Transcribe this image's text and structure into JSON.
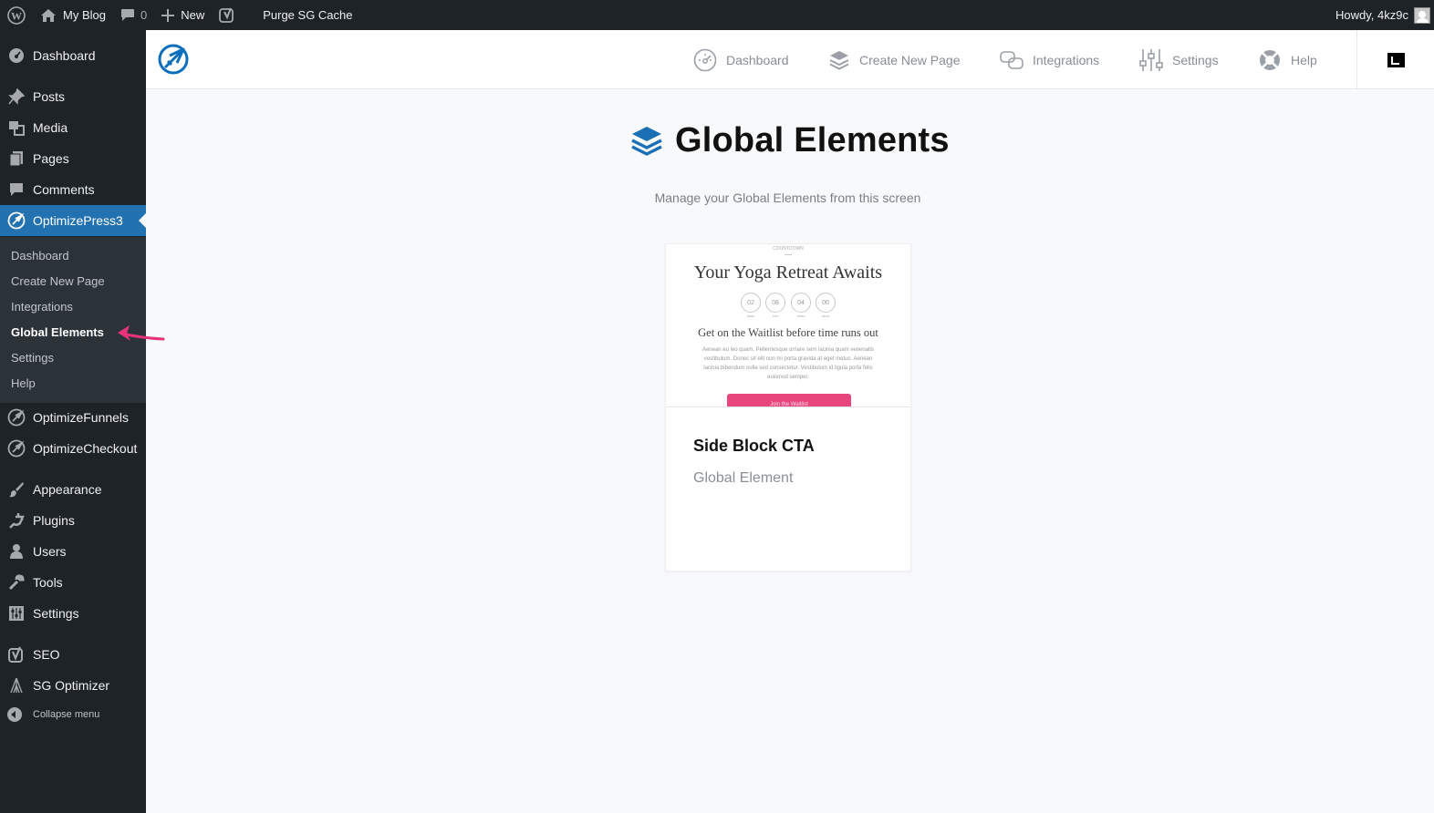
{
  "admin_bar": {
    "site_name": "My Blog",
    "comments_count": "0",
    "new_label": "New",
    "purge_label": "Purge SG Cache",
    "greeting": "Howdy, 4kz9c"
  },
  "sidebar": {
    "items": [
      {
        "label": "Dashboard",
        "icon": "dashboard-gauge-icon"
      },
      {
        "label": "Posts",
        "icon": "pushpin-icon"
      },
      {
        "label": "Media",
        "icon": "media-icon"
      },
      {
        "label": "Pages",
        "icon": "pages-icon"
      },
      {
        "label": "Comments",
        "icon": "comment-bubble-icon"
      },
      {
        "label": "OptimizePress3",
        "icon": "optimizepress-icon"
      },
      {
        "label": "OptimizeFunnels",
        "icon": "optimizepress-icon"
      },
      {
        "label": "OptimizeCheckout",
        "icon": "optimizepress-icon"
      },
      {
        "label": "Appearance",
        "icon": "paintbrush-icon"
      },
      {
        "label": "Plugins",
        "icon": "plug-icon"
      },
      {
        "label": "Users",
        "icon": "user-icon"
      },
      {
        "label": "Tools",
        "icon": "wrench-icon"
      },
      {
        "label": "Settings",
        "icon": "settings-sliders-icon"
      },
      {
        "label": "SEO",
        "icon": "yoast-icon"
      },
      {
        "label": "SG Optimizer",
        "icon": "sg-optimizer-icon"
      }
    ],
    "submenu": [
      {
        "label": "Dashboard"
      },
      {
        "label": "Create New Page"
      },
      {
        "label": "Integrations"
      },
      {
        "label": "Global Elements"
      },
      {
        "label": "Settings"
      },
      {
        "label": "Help"
      }
    ],
    "collapse_label": "Collapse menu"
  },
  "topnav": {
    "links": [
      {
        "label": "Dashboard",
        "icon": "gauge-icon"
      },
      {
        "label": "Create New Page",
        "icon": "layers-icon"
      },
      {
        "label": "Integrations",
        "icon": "integrations-icon"
      },
      {
        "label": "Settings",
        "icon": "sliders-icon"
      },
      {
        "label": "Help",
        "icon": "lifebuoy-icon"
      }
    ]
  },
  "main": {
    "title": "Global Elements",
    "subtitle": "Manage your Global Elements from this screen"
  },
  "card": {
    "preview": {
      "eyebrow": "COUNTDOWN",
      "title": "Your Yoga Retreat Awaits",
      "countdown": [
        {
          "value": "02",
          "unit": "days"
        },
        {
          "value": "08",
          "unit": "hrs"
        },
        {
          "value": "04",
          "unit": "mins"
        },
        {
          "value": "00",
          "unit": "secs"
        }
      ],
      "subtitle": "Get on the Waitlist before time runs out",
      "body": "Aenean eu leo quam. Pellentesque ornare sem lacinia quam venenatis vestibulum. Donec sit elit non mi porta gravida at eget metus. Aenean lacinia bibendum nulla sed consectetur. Vestibulum id ligula porta felis euismod semper.",
      "button": "Join the Waitlist"
    },
    "title": "Side Block CTA",
    "type": "Global Element"
  },
  "colors": {
    "admin_bg": "#1d2327",
    "submenu_bg": "#2c3338",
    "accent": "#2271b1",
    "op_blue": "#0d6ebd",
    "annotation_arrow": "#e6337a",
    "preview_button": "#e8457c"
  }
}
